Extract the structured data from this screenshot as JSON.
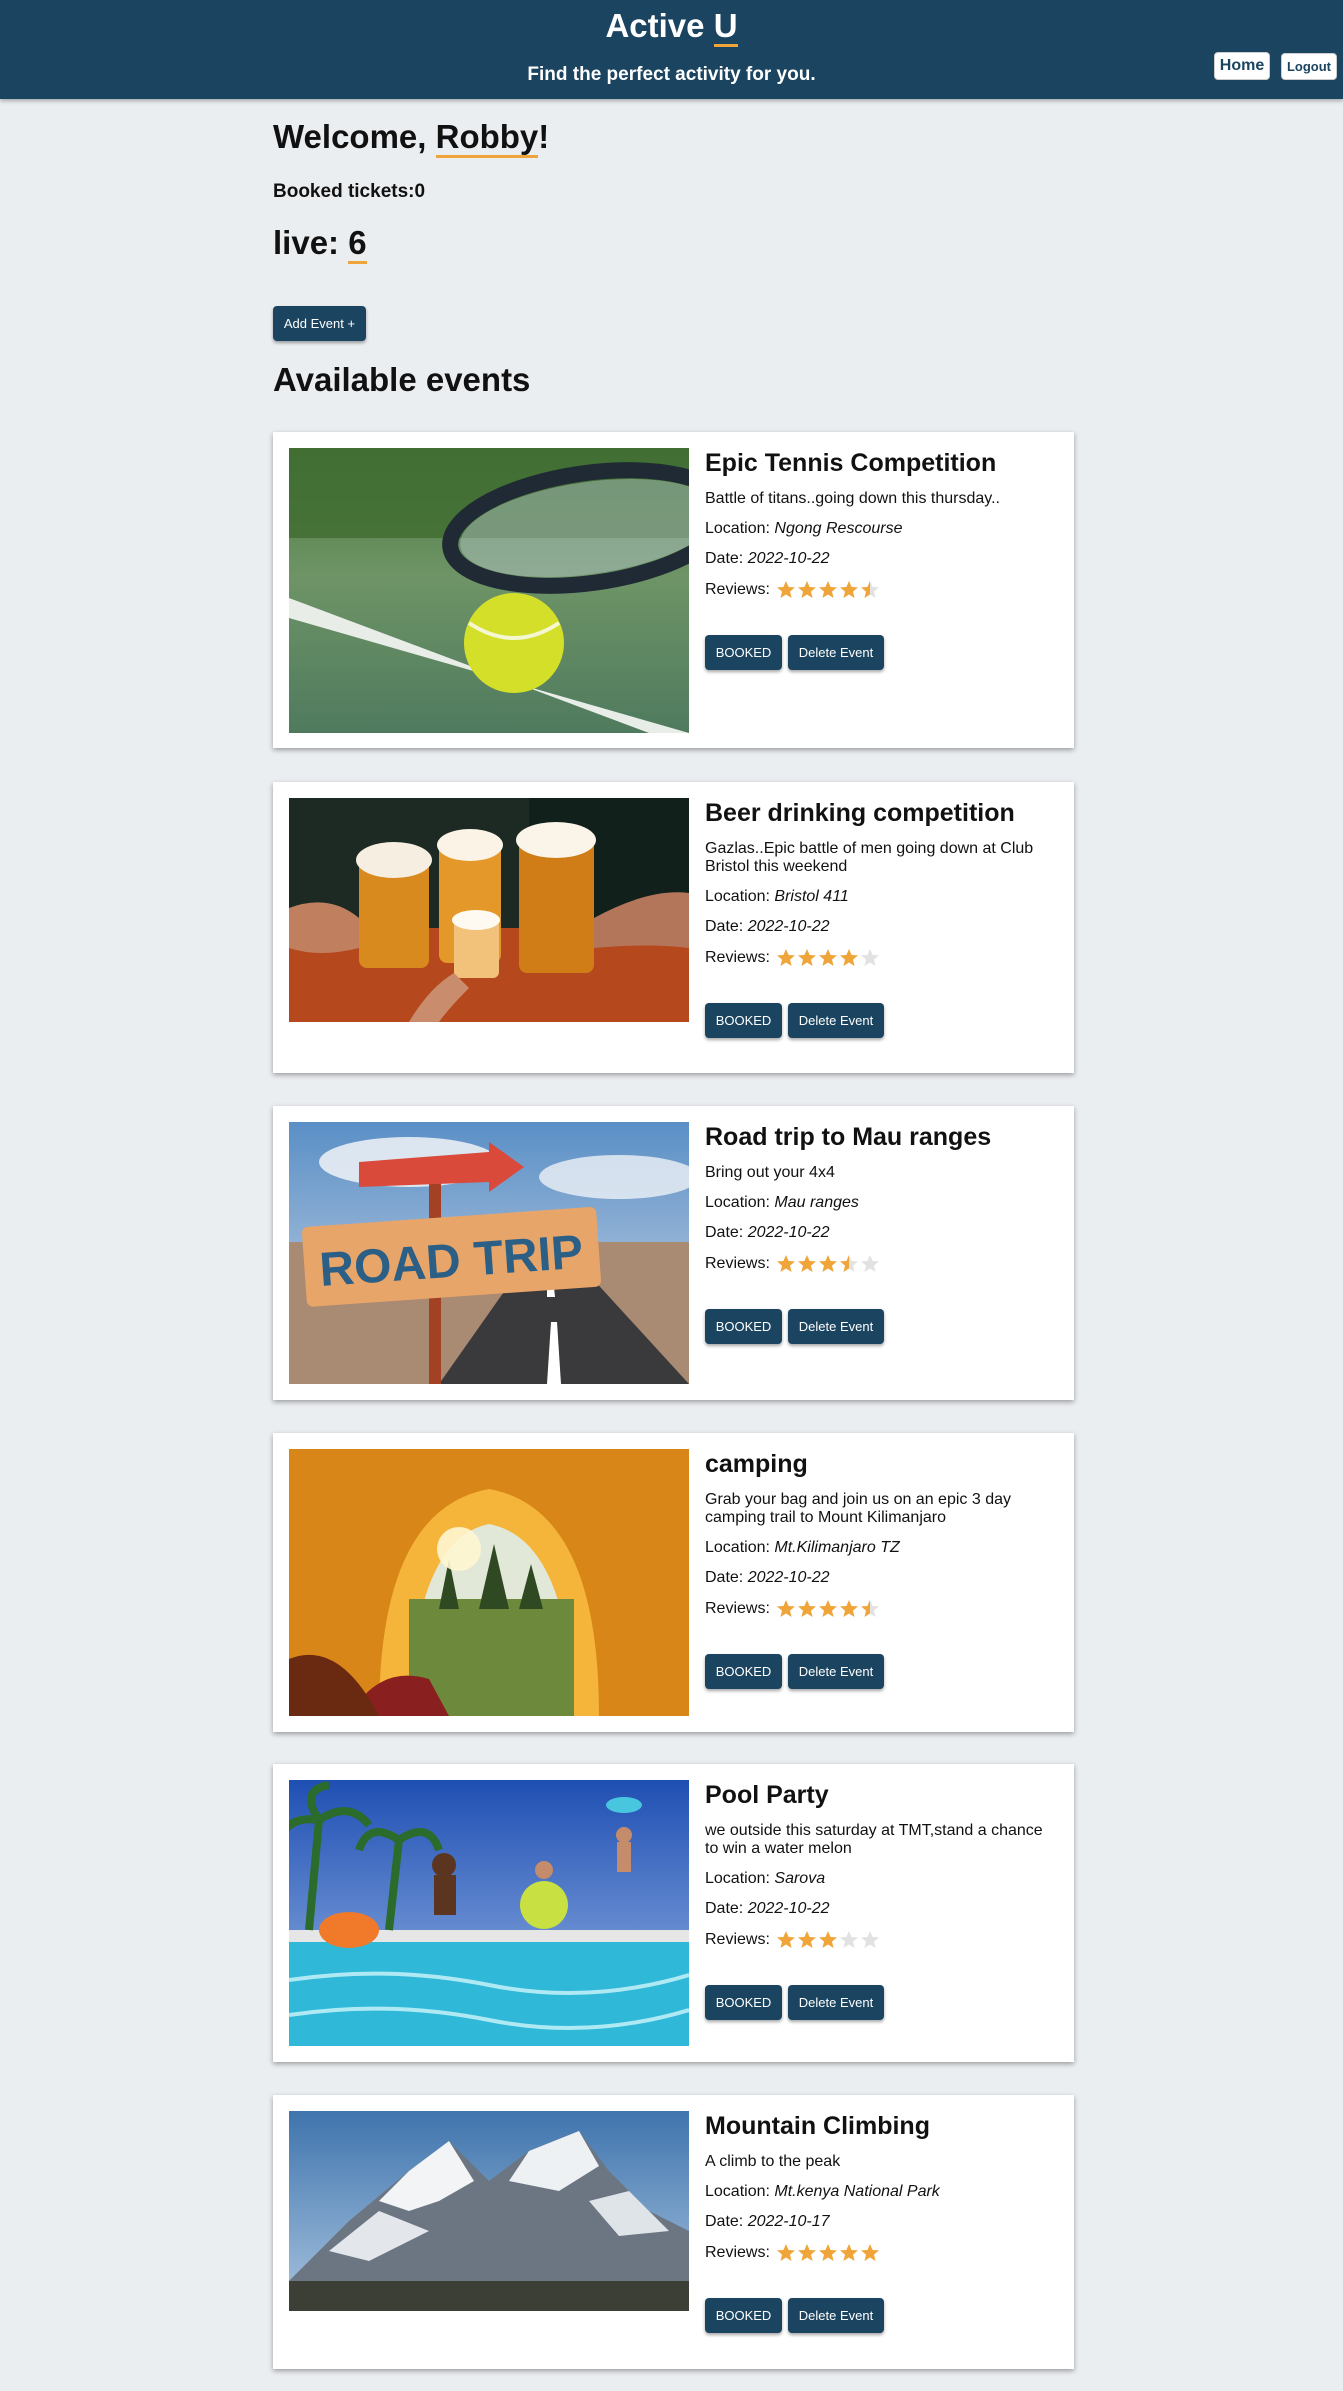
{
  "header": {
    "brand_prefix": "Active ",
    "brand_accent": "U",
    "tagline": "Find the perfect activity for you.",
    "home_label": "Home",
    "logout_label": "Logout"
  },
  "user": {
    "welcome_prefix": "Welcome, ",
    "name": "Robby",
    "welcome_suffix": "!",
    "booked_text": "Booked tickets:0",
    "live_prefix": "live: ",
    "live_count": "6"
  },
  "actions": {
    "add_event_label": "Add Event +"
  },
  "section_title": "Available events",
  "labels": {
    "location": "Location: ",
    "date": "Date: ",
    "reviews": "Reviews:",
    "booked_button": "BOOKED",
    "delete_button": "Delete Event"
  },
  "colors": {
    "header_bg": "#1b4460",
    "accent": "#f0a53a",
    "page_bg": "#ebeef1",
    "star_empty": "#e2e2e2"
  },
  "events": [
    {
      "title": "Epic Tennis Competition",
      "description": "Battle of titans..going down this thursday..",
      "location": "Ngong Rescourse",
      "date": "2022-10-22",
      "rating": 4.5,
      "image": "tennis-racket-ball-photo"
    },
    {
      "title": "Beer drinking competition",
      "description": "Gazlas..Epic battle of men going down at Club Bristol this weekend",
      "location": "Bristol 411",
      "date": "2022-10-22",
      "rating": 4,
      "image": "beer-toast-photo"
    },
    {
      "title": "Road trip to Mau ranges",
      "description": "Bring out your 4x4",
      "location": "Mau ranges",
      "date": "2022-10-22",
      "rating": 3.5,
      "image": "road-trip-sign-photo"
    },
    {
      "title": "camping",
      "description": "Grab your bag and join us on an epic 3 day camping trail to Mount Kilimanjaro",
      "location": "Mt.Kilimanjaro TZ",
      "date": "2022-10-22",
      "rating": 4.5,
      "image": "tent-view-photo"
    },
    {
      "title": "Pool Party",
      "description": "we outside this saturday at TMT,stand a chance to win a water melon",
      "location": "Sarova",
      "date": "2022-10-22",
      "rating": 3,
      "image": "pool-party-photo"
    },
    {
      "title": "Mountain Climbing",
      "description": "A climb to the peak",
      "location": "Mt.kenya National Park",
      "date": "2022-10-17",
      "rating": 5,
      "image": "snowy-mountain-photo"
    }
  ]
}
